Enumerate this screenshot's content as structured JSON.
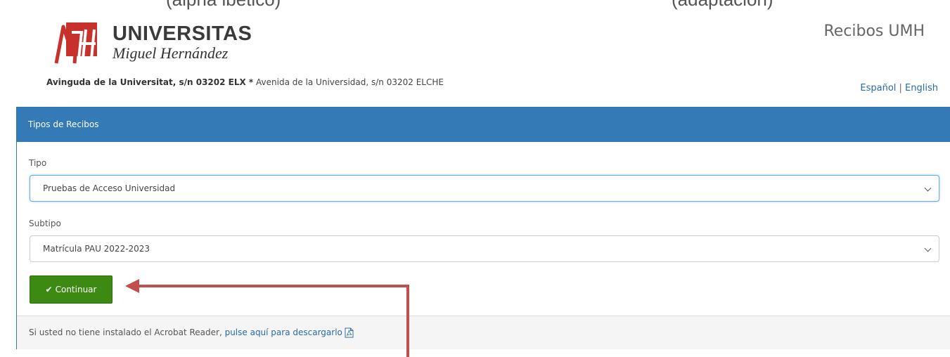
{
  "top_strip": {
    "left_text": "(alpha ibetico)",
    "right_text": "(adaptacion)"
  },
  "header": {
    "logo_line1": "UNIVERSITAS",
    "logo_line2": "Miguel Hernández",
    "app_title": "Recibos UMH",
    "address_bold": "Avinguda de la Universitat, s/n 03202 ELX *",
    "address_rest": " Avenida de la Universidad, s/n 03202 ELCHE",
    "lang_es": "Español",
    "lang_sep": " | ",
    "lang_en": "English"
  },
  "panel": {
    "heading": "Tipos de Recibos",
    "tipo_label": "Tipo",
    "tipo_value": "Pruebas de Acceso Universidad",
    "subtipo_label": "Subtipo",
    "subtipo_value": "Matrícula PAU 2022-2023",
    "continue_label": "Continuar"
  },
  "footer": {
    "text": "Si usted no tiene instalado el Acrobat Reader, ",
    "link": "pulse aquí para descargarlo"
  },
  "colors": {
    "brand_red": "#c8312b",
    "panel_blue": "#337ab7",
    "button_green": "#3c8a12",
    "arrow_red": "#c0504d"
  },
  "icons": {
    "check": "check-icon",
    "pdf": "pdf-file-icon",
    "select": "chevron-down-icon"
  }
}
